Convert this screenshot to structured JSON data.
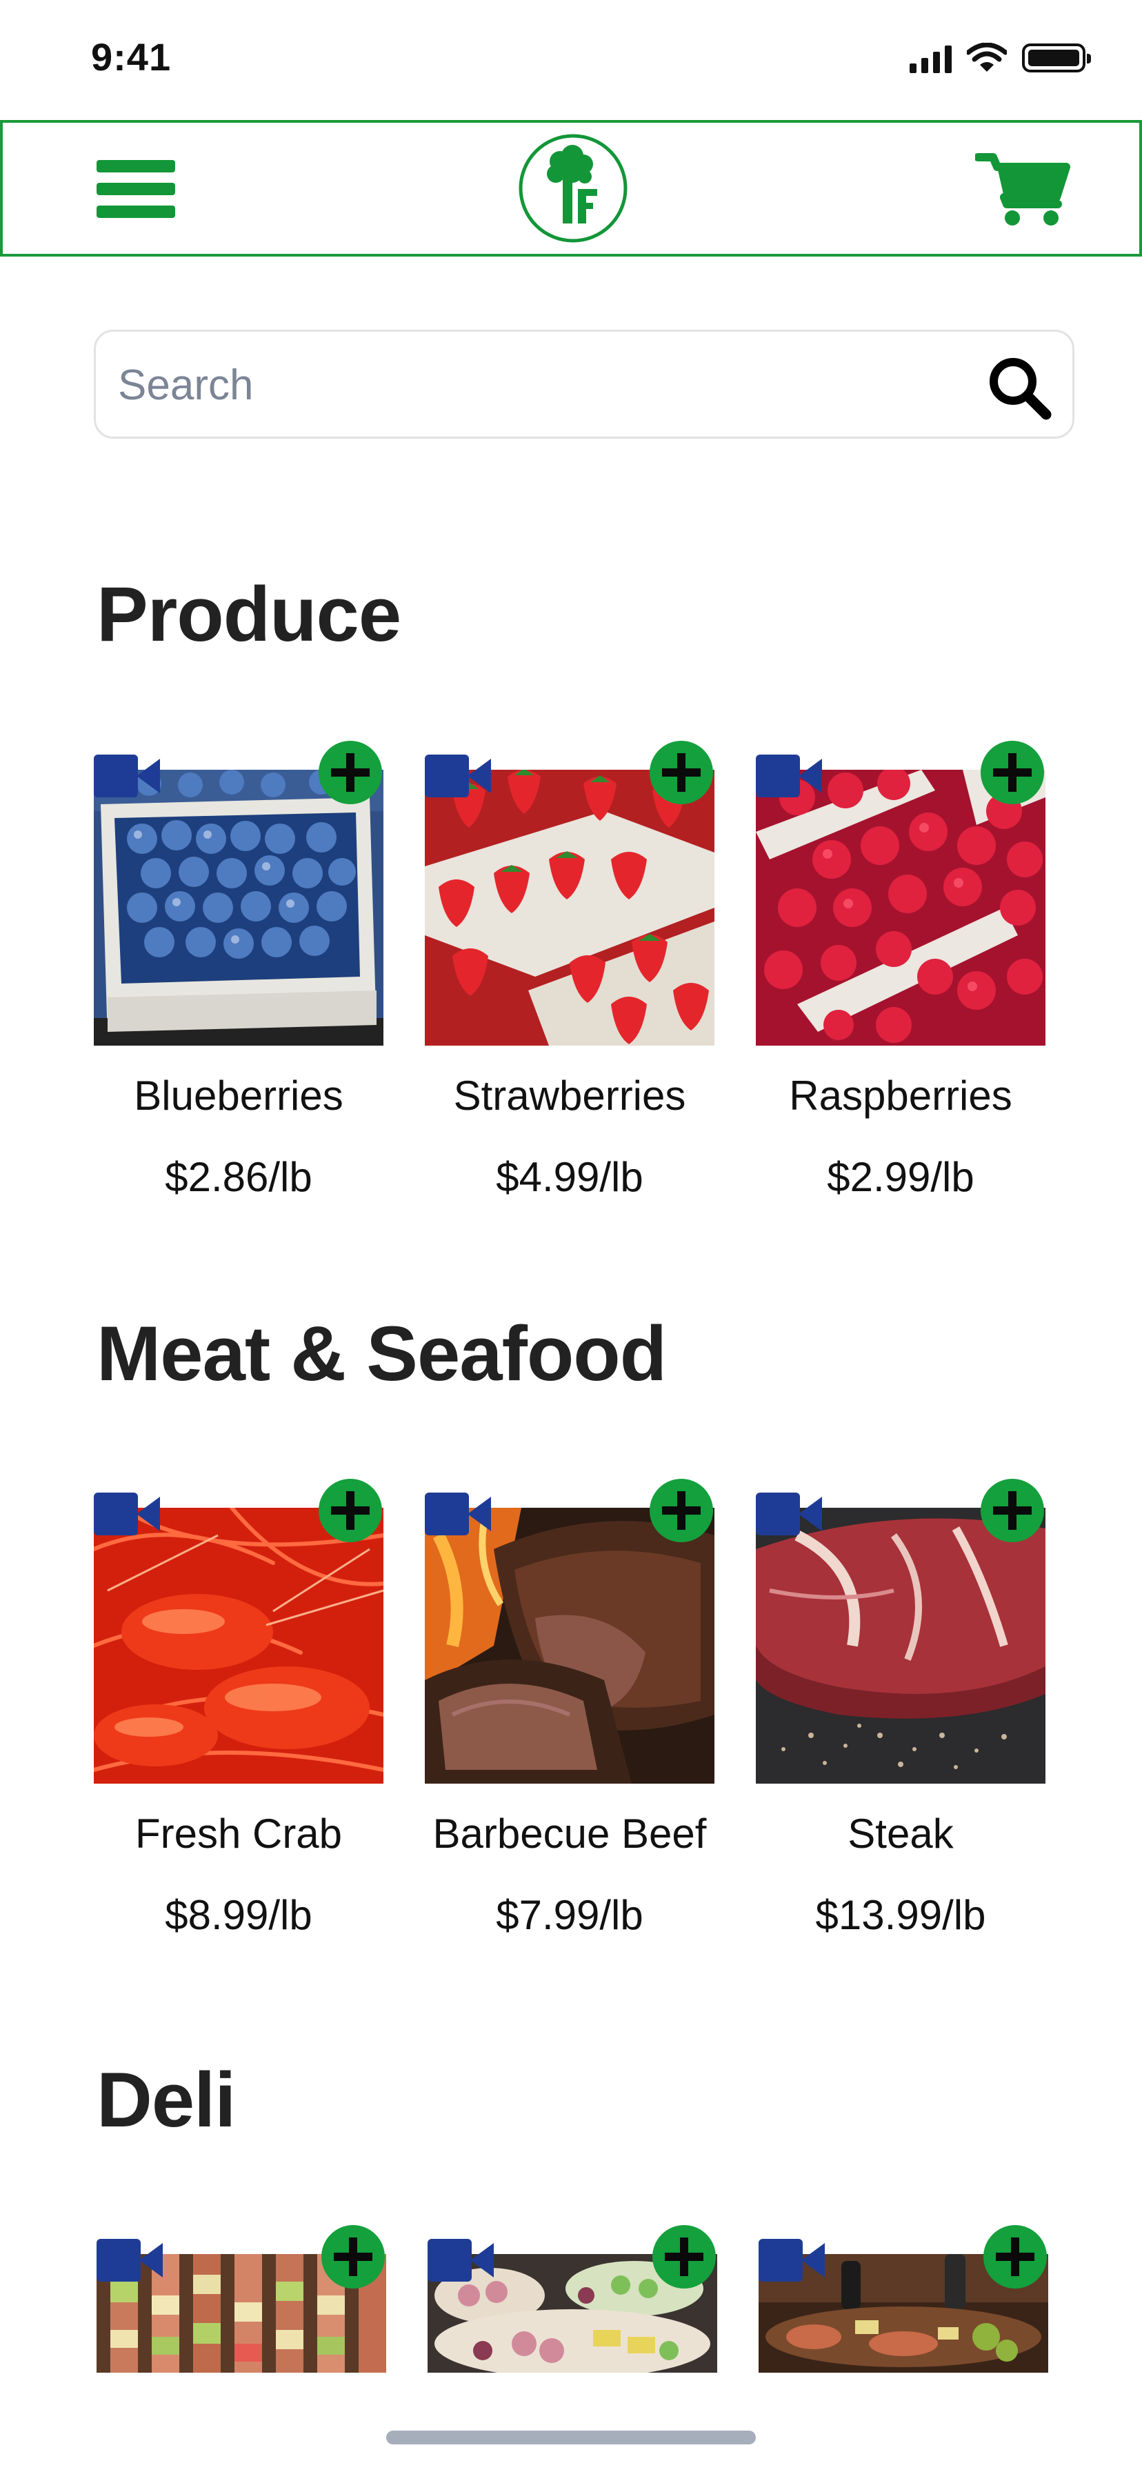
{
  "status_bar": {
    "time": "9:41"
  },
  "header": {
    "menu_icon": "hamburger-icon",
    "logo_icon": "tree-logo",
    "cart_icon": "shopping-cart-icon",
    "accent_color": "#129638"
  },
  "search": {
    "placeholder": "Search",
    "value": ""
  },
  "sections": [
    {
      "title": "Produce",
      "products": [
        {
          "name": "Blueberries",
          "price": "$2.86/lb"
        },
        {
          "name": "Strawberries",
          "price": "$4.99/lb"
        },
        {
          "name": "Raspberries",
          "price": "$2.99/lb"
        }
      ]
    },
    {
      "title": "Meat & Seafood",
      "products": [
        {
          "name": "Fresh Crab",
          "price": "$8.99/lb"
        },
        {
          "name": "Barbecue Beef",
          "price": "$7.99/lb"
        },
        {
          "name": "Steak",
          "price": "$13.99/lb"
        }
      ]
    },
    {
      "title": "Deli",
      "products": [
        {
          "name": "",
          "price": ""
        },
        {
          "name": "",
          "price": ""
        },
        {
          "name": "",
          "price": ""
        }
      ]
    }
  ]
}
